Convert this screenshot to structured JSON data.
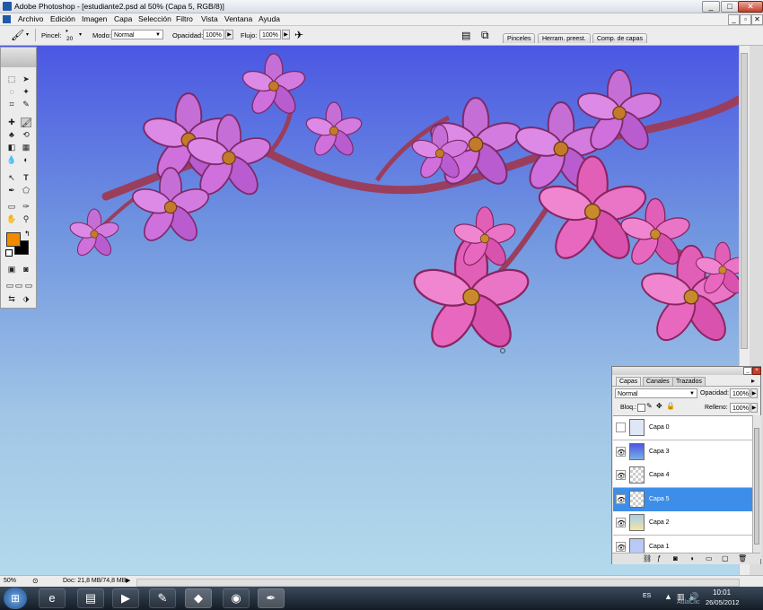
{
  "window": {
    "title": "Adobe Photoshop - [estudiante2.psd al 50% (Capa 5, RGB/8)]",
    "min": "_",
    "max": "□",
    "close": "✕"
  },
  "menu": [
    "Archivo",
    "Edición",
    "Imagen",
    "Capa",
    "Selección",
    "Filtro",
    "Vista",
    "Ventana",
    "Ayuda"
  ],
  "doc_controls": [
    "_",
    "▫",
    "✕"
  ],
  "options": {
    "brush_label": "Pincel:",
    "brush_size": "20",
    "mode_label": "Modo:",
    "mode_value": "Normal",
    "opacity_label": "Opacidad:",
    "opacity_value": "100%",
    "flow_label": "Flujo:",
    "flow_value": "100%",
    "well_tabs": [
      "Pinceles",
      "Herram. preest.",
      "Comp. de capas"
    ]
  },
  "tools": {
    "foreground_color": "#f28a00",
    "background_color": "#000000"
  },
  "layers_panel": {
    "tabs": [
      "Capas",
      "Canales",
      "Trazados"
    ],
    "blend_mode": "Normal",
    "opacity_label": "Opacidad:",
    "opacity_value": "100%",
    "lock_label": "Bloq.:",
    "fill_label": "Relleno:",
    "fill_value": "100%",
    "layers": [
      {
        "name": "Capa 0",
        "visible": false,
        "selected": false
      },
      {
        "name": "Capa 3",
        "visible": true,
        "selected": false
      },
      {
        "name": "Capa 4",
        "visible": true,
        "selected": false
      },
      {
        "name": "Capa 5",
        "visible": true,
        "selected": true
      },
      {
        "name": "Capa 2",
        "visible": true,
        "selected": false
      },
      {
        "name": "Capa 1",
        "visible": true,
        "selected": false
      }
    ]
  },
  "status": {
    "zoom": "50%",
    "doc": "Doc: 21,8 MB/74,8 MB"
  },
  "taskbar": {
    "language": "ES",
    "time": "10:01",
    "date": "26/05/2012",
    "watermark": "AulaClic"
  }
}
